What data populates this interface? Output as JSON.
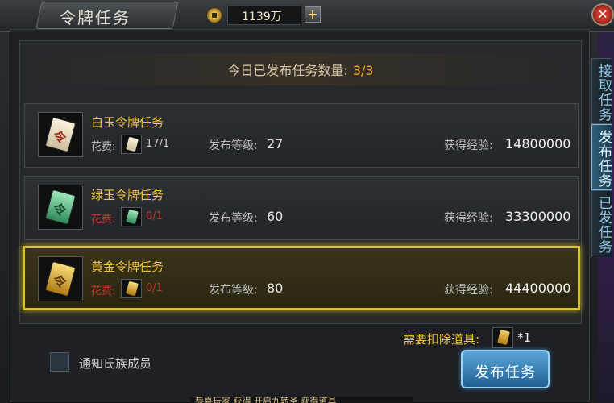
{
  "window": {
    "title": "令牌任务"
  },
  "currency": {
    "amount": "1139万",
    "add_label": "+"
  },
  "close_label": "✕",
  "summary": {
    "label": "今日已发布任务数量:",
    "value": "3/3"
  },
  "tasks": [
    {
      "name": "白玉令牌任务",
      "cost_label": "花费:",
      "cost_value": "17/1",
      "level_label": "发布等级:",
      "level_value": "27",
      "exp_label": "获得经验:",
      "exp_value": "14800000",
      "token_color": "#efe6cc",
      "cost_insufficient": false,
      "selected": false
    },
    {
      "name": "绿玉令牌任务",
      "cost_label": "花费:",
      "cost_value": "0/1",
      "level_label": "发布等级:",
      "level_value": "60",
      "exp_label": "获得经验:",
      "exp_value": "33300000",
      "token_color": "#6fcf9a",
      "cost_insufficient": true,
      "selected": false
    },
    {
      "name": "黄金令牌任务",
      "cost_label": "花费:",
      "cost_value": "0/1",
      "level_label": "发布等级:",
      "level_value": "80",
      "exp_label": "获得经验:",
      "exp_value": "44400000",
      "token_color": "#e6b93a",
      "cost_insufficient": true,
      "selected": true
    }
  ],
  "side_tabs": [
    {
      "label": "接取任务",
      "active": false
    },
    {
      "label": "发布任务",
      "active": true
    },
    {
      "label": "已发任务",
      "active": false
    }
  ],
  "deduct": {
    "label": "需要扣除道具:",
    "qty": "*1"
  },
  "notify": {
    "label": "通知氏族成员",
    "checked": false
  },
  "publish_button": {
    "label": "发布任务"
  },
  "bottom_banner": "恭喜玩家 获得 开启九转圣 获得道具",
  "colors": {
    "accent_gold": "#f2c640",
    "selected_border": "#d8c32a",
    "insufficient_red": "#c03a2e",
    "button_blue": "#2f7fba"
  }
}
